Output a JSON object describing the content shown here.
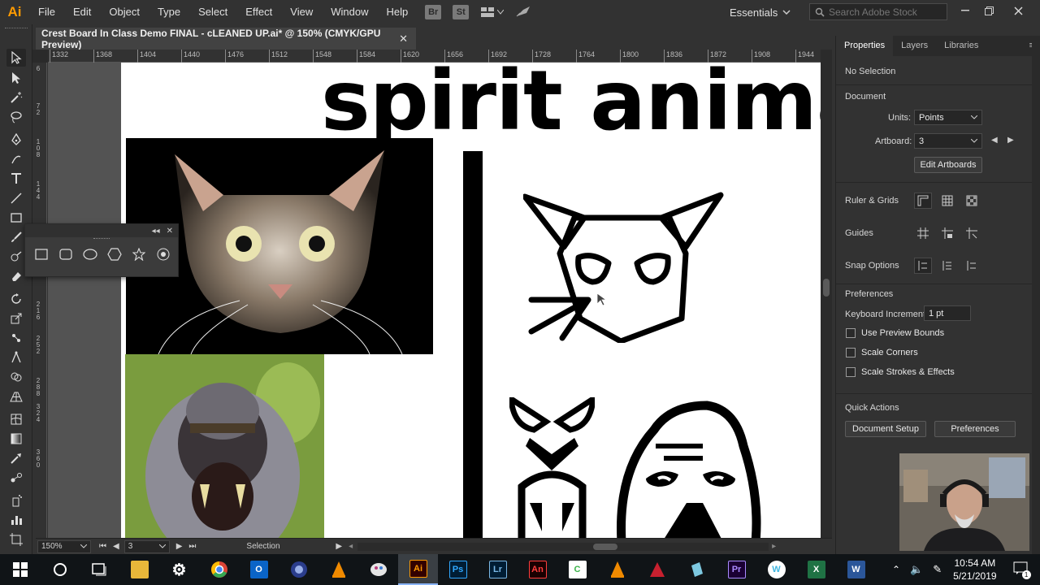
{
  "app": {
    "logo_text": "Ai",
    "brand_color": "#ff9a00"
  },
  "menubar": {
    "items": [
      "File",
      "Edit",
      "Object",
      "Type",
      "Select",
      "Effect",
      "View",
      "Window",
      "Help"
    ],
    "bridge_label": "Br",
    "stock_label": "St",
    "workspace": "Essentials",
    "search_placeholder": "Search Adobe Stock"
  },
  "document": {
    "tab_title": "Crest Board In Class Demo FINAL - cLEANED UP.ai* @ 150% (CMYK/GPU Preview)",
    "close_glyph": "✕"
  },
  "rulers": {
    "h_ticks": [
      "1332",
      "1368",
      "1404",
      "1440",
      "1476",
      "1512",
      "1548",
      "1584",
      "1620",
      "1656",
      "1692",
      "1728",
      "1764",
      "1800",
      "1836",
      "1872",
      "1908",
      "1944"
    ],
    "v_ticks": [
      "6",
      "7",
      "2",
      "1",
      "0",
      "8",
      "1",
      "4",
      "4",
      "1",
      "8",
      "0",
      "2",
      "1",
      "6",
      "2",
      "5",
      "2",
      "2",
      "8",
      "8",
      "3",
      "2",
      "4",
      "3",
      "6",
      "0"
    ]
  },
  "artwork": {
    "title": "spirit animals"
  },
  "statusbar": {
    "zoom": "150%",
    "artboard_num": "3",
    "tool_name": "Selection"
  },
  "properties": {
    "tabs": [
      "Properties",
      "Layers",
      "Libraries"
    ],
    "selection_state": "No Selection",
    "document_heading": "Document",
    "units_label": "Units:",
    "units_value": "Points",
    "artboard_label": "Artboard:",
    "artboard_value": "3",
    "edit_artboards": "Edit Artboards",
    "ruler_grids": "Ruler & Grids",
    "guides": "Guides",
    "snap_options": "Snap Options",
    "preferences_heading": "Preferences",
    "keyboard_increment_label": "Keyboard Increment:",
    "keyboard_increment_value": "1 pt",
    "use_preview_bounds": "Use Preview Bounds",
    "scale_corners": "Scale Corners",
    "scale_strokes": "Scale Strokes & Effects",
    "quick_actions": "Quick Actions",
    "document_setup": "Document Setup",
    "preferences_button": "Preferences"
  },
  "taskbar": {
    "apps": [
      {
        "name": "file-explorer",
        "label": "",
        "color": "#e8b73a"
      },
      {
        "name": "settings",
        "label": "⚙",
        "color": "#ffffff"
      },
      {
        "name": "chrome",
        "label": "",
        "color": "#34a853"
      },
      {
        "name": "outlook",
        "label": "O",
        "color": "#0a64c7"
      },
      {
        "name": "c4d",
        "label": "",
        "color": "#2b3d8c"
      },
      {
        "name": "vlc",
        "label": "",
        "color": "#f08a00"
      },
      {
        "name": "app-redbird",
        "label": "",
        "color": "#b83c7a"
      },
      {
        "name": "illustrator",
        "label": "Ai",
        "color": "#ff9a00"
      },
      {
        "name": "photoshop",
        "label": "Ps",
        "color": "#31a8ff"
      },
      {
        "name": "lightroom",
        "label": "Lr",
        "color": "#7ab8e6"
      },
      {
        "name": "animate",
        "label": "An",
        "color": "#ff3d3d"
      },
      {
        "name": "camtasia",
        "label": "C",
        "color": "#3bb34a"
      },
      {
        "name": "vlc-2",
        "label": "",
        "color": "#f08a00"
      },
      {
        "name": "autodesk",
        "label": "",
        "color": "#c8202f"
      },
      {
        "name": "sketchup",
        "label": "",
        "color": "#7dc8e0"
      },
      {
        "name": "premiere",
        "label": "Pr",
        "color": "#a98bff"
      },
      {
        "name": "webex",
        "label": "W",
        "color": "#3fb6e0"
      },
      {
        "name": "excel",
        "label": "X",
        "color": "#1f7244"
      },
      {
        "name": "word",
        "label": "W",
        "color": "#2b5699"
      }
    ],
    "time": "10:54 AM",
    "date": "5/21/2019",
    "notification_count": "1"
  }
}
